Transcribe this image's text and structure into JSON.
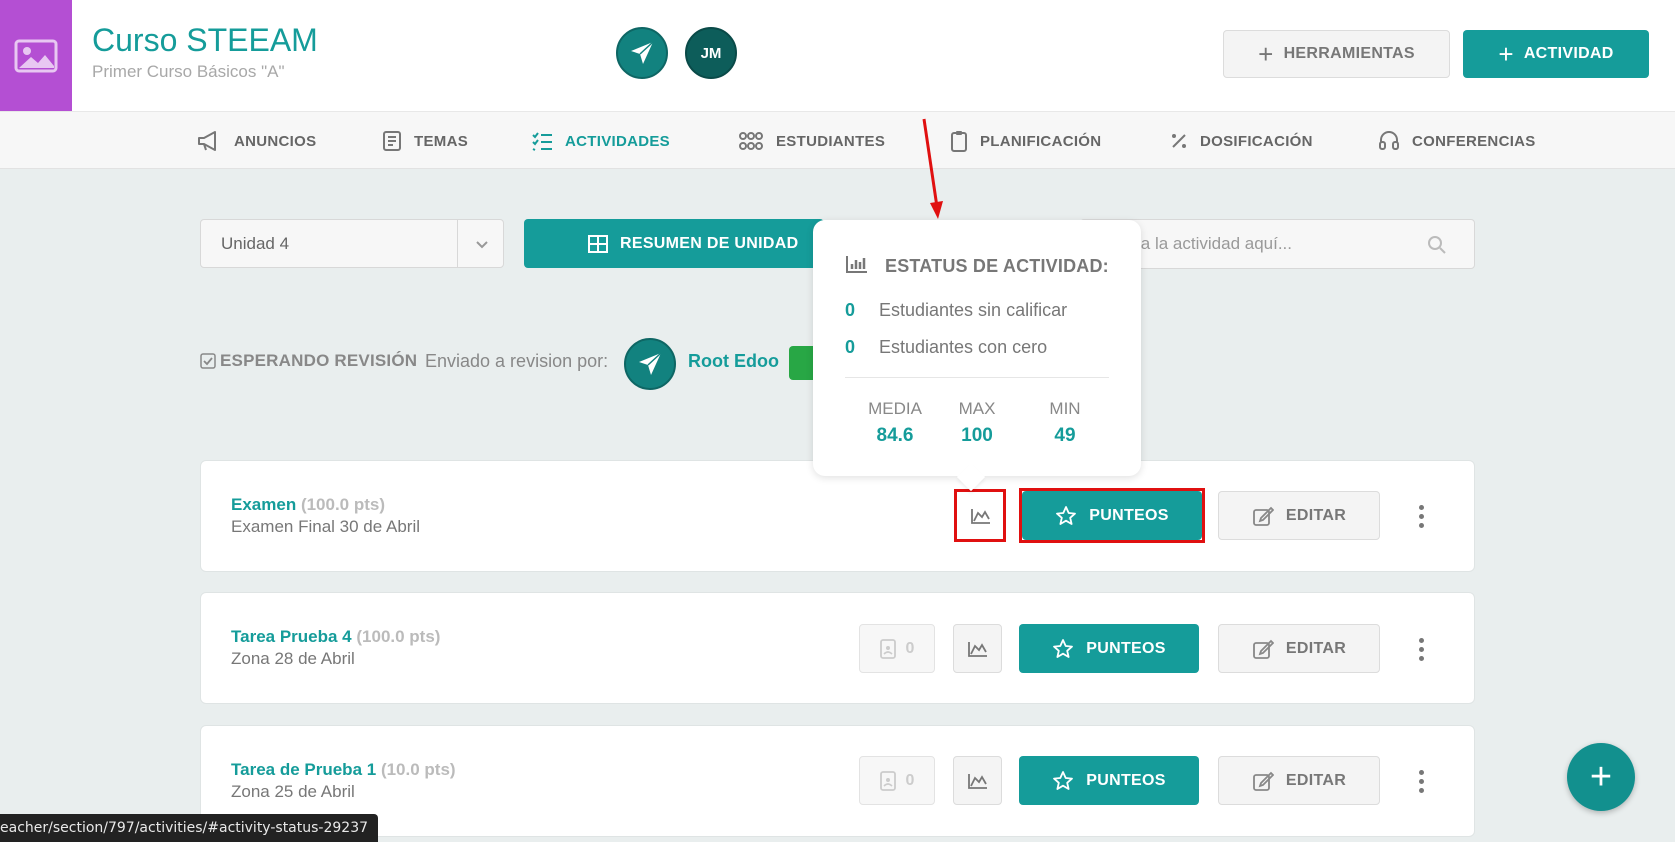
{
  "course": {
    "title": "Curso STEEAM",
    "subtitle": "Primer Curso Básicos \"A\"",
    "image_icon": "image-icon"
  },
  "header": {
    "avatar_user_initials": "JM",
    "tools_label": "HERRAMIENTAS",
    "activity_label": "ACTIVIDAD"
  },
  "nav": {
    "items": [
      {
        "label": "ANUNCIOS",
        "icon": "megaphone-icon"
      },
      {
        "label": "TEMAS",
        "icon": "book-icon"
      },
      {
        "label": "ACTIVIDADES",
        "icon": "checklist-icon",
        "active": true
      },
      {
        "label": "ESTUDIANTES",
        "icon": "people-icon"
      },
      {
        "label": "PLANIFICACIÓN",
        "icon": "clipboard-icon"
      },
      {
        "label": "DOSIFICACIÓN",
        "icon": "percent-icon"
      },
      {
        "label": "CONFERENCIAS",
        "icon": "headset-icon"
      }
    ]
  },
  "toolbar": {
    "unit_selected": "Unidad 4",
    "summary_label": "RESUMEN DE UNIDAD",
    "search_placeholder": "Busca la actividad aquí..."
  },
  "review": {
    "label": "ESPERANDO REVISIÓN",
    "sent_by_label": "Enviado a revision por:",
    "reviewer_name": "Root Edoo"
  },
  "popover": {
    "title": "ESTATUS DE ACTIVIDAD:",
    "ungraded_count": "0",
    "ungraded_label": "Estudiantes sin calificar",
    "zero_count": "0",
    "zero_label": "Estudiantes con cero",
    "mean_label": "MEDIA",
    "mean_value": "84.6",
    "max_label": "MAX",
    "max_value": "100",
    "min_label": "MIN",
    "min_value": "49"
  },
  "activities": [
    {
      "title": "Examen",
      "points": "(100.0 pts)",
      "subtitle": "Examen Final 30 de Abril",
      "count": ""
    },
    {
      "title": "Tarea Prueba 4",
      "points": "(100.0 pts)",
      "subtitle": "Zona 28 de Abril",
      "count": "0"
    },
    {
      "title": "Tarea de Prueba 1",
      "points": "(10.0 pts)",
      "subtitle": "Zona 25 de Abril",
      "count": "0"
    }
  ],
  "actions": {
    "scores_label": "PUNTEOS",
    "edit_label": "EDITAR"
  },
  "status_url": "eacher/section/797/activities/#activity-status-29237",
  "colors": {
    "accent": "#159c9a",
    "course_image": "#b44fd3",
    "highlight": "#e01010"
  }
}
